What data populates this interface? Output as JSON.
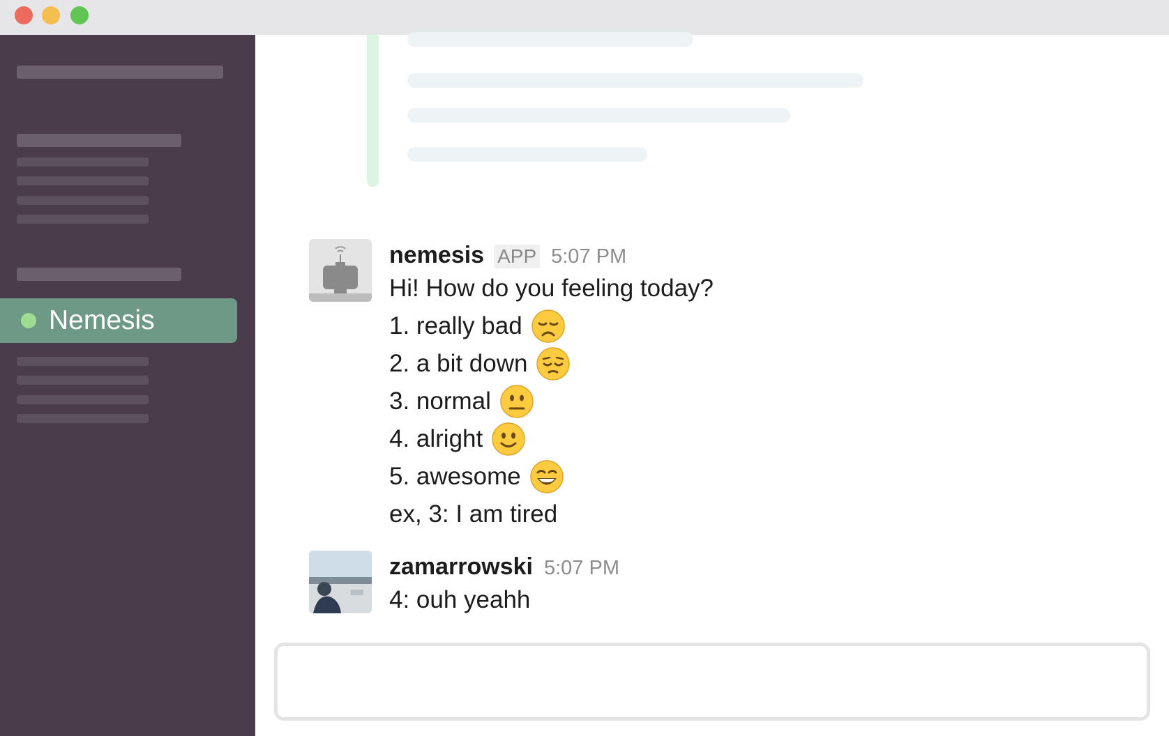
{
  "window": {
    "controls": [
      "close",
      "minimize",
      "maximize"
    ]
  },
  "sidebar": {
    "active_item": {
      "label": "Nemesis",
      "status": "online"
    }
  },
  "messages": [
    {
      "author": "nemesis",
      "badge": "APP",
      "time": "5:07 PM",
      "avatar": "robot-avatar-icon",
      "lines": [
        {
          "text": "Hi! How do you feeling today?"
        },
        {
          "text": "1. really bad",
          "emoji": "disappointed-face-emoji"
        },
        {
          "text": "2. a bit down",
          "emoji": "pensive-face-emoji"
        },
        {
          "text": "3. normal",
          "emoji": "neutral-face-emoji"
        },
        {
          "text": "4. alright",
          "emoji": "slightly-smiling-face-emoji"
        },
        {
          "text": "5. awesome",
          "emoji": "grinning-face-emoji"
        },
        {
          "text": "ex, 3: I am tired"
        }
      ]
    },
    {
      "author": "zamarrowski",
      "time": "5:07 PM",
      "avatar": "user-photo-avatar",
      "lines": [
        {
          "text": "4: ouh yeahh"
        }
      ]
    }
  ],
  "composer": {
    "placeholder": ""
  },
  "colors": {
    "sidebar_bg": "#4a3c4b",
    "active_item_bg": "#6e9987",
    "presence_online": "#9fdc93",
    "attachment_accent": "#def4e3"
  }
}
